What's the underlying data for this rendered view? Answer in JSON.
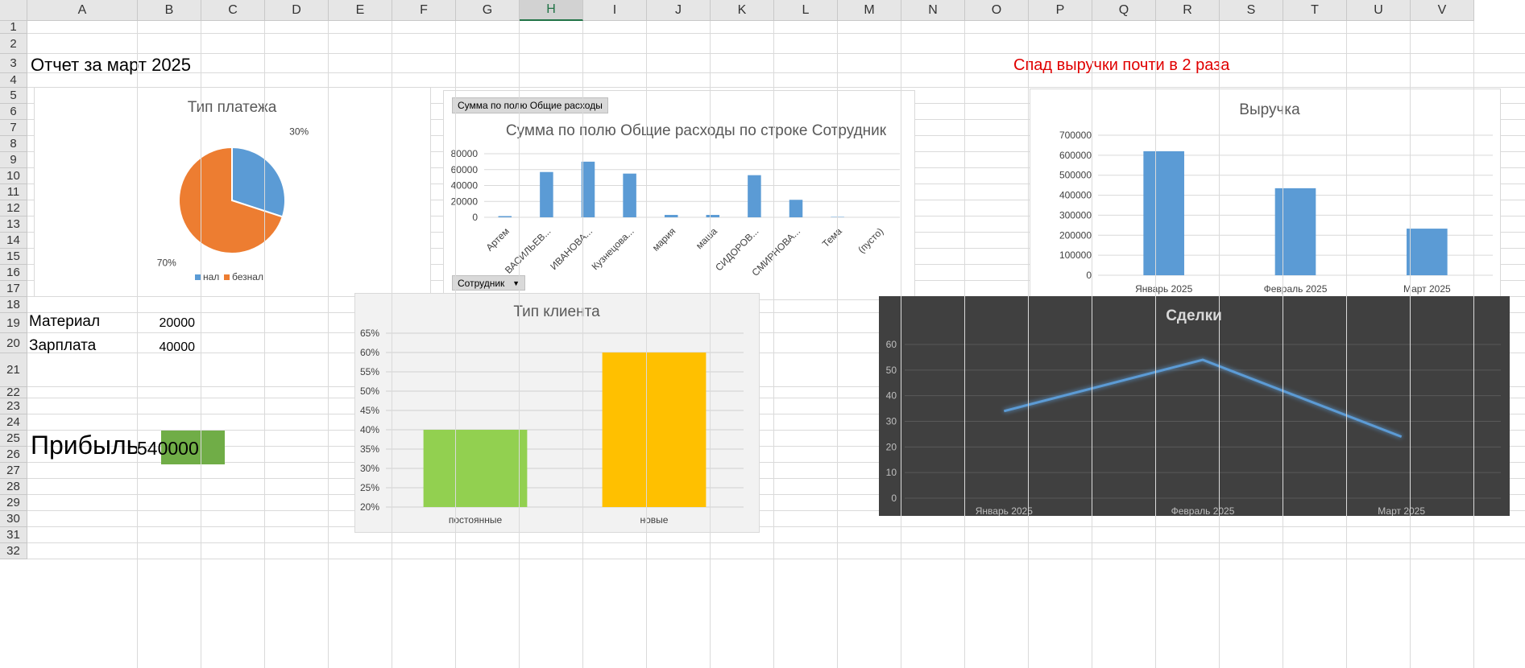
{
  "columns": [
    "A",
    "B",
    "C",
    "D",
    "E",
    "F",
    "G",
    "H",
    "I",
    "J",
    "K",
    "L",
    "M",
    "N",
    "O",
    "P",
    "Q",
    "R",
    "S",
    "T",
    "U",
    "V"
  ],
  "selected_column": "H",
  "rows": [
    "1",
    "2",
    "3",
    "4",
    "5",
    "6",
    "7",
    "8",
    "9",
    "10",
    "11",
    "12",
    "13",
    "14",
    "15",
    "16",
    "17",
    "18",
    "19",
    "20",
    "21",
    "22",
    "23",
    "24",
    "25",
    "26",
    "27",
    "28",
    "29",
    "30",
    "31",
    "32"
  ],
  "cells": {
    "title": "Отчет за март 2025",
    "note": "Спад выручки почти в 2 раза",
    "material_label": "Материал",
    "material_value": "20000",
    "salary_label": "Зарплата",
    "salary_value": "40000",
    "profit_label": "Прибыль",
    "profit_value": "540000"
  },
  "colors": {
    "note": "#e00000",
    "profit_fill": "#70ad47",
    "blue": "#5b9bd5",
    "orange": "#ed7d31",
    "green": "#92d050",
    "yellow": "#ffc000",
    "dark_bg": "#404040"
  },
  "pivot": {
    "field_button": "Сумма по полю Общие расходы",
    "row_button": "Сотрудник",
    "row_button_icon": "dropdown-arrow-icon"
  },
  "chart_data": [
    {
      "id": "payment",
      "type": "pie",
      "title": "Тип платежа",
      "categories": [
        "нал",
        "безнал"
      ],
      "values": [
        30,
        70
      ],
      "data_labels": [
        "30%",
        "70%"
      ],
      "legend": "bottom"
    },
    {
      "id": "expenses",
      "type": "bar",
      "title": "Сумма по полю Общие расходы по строке Сотрудник",
      "categories": [
        "Артем",
        "ВАСИЛЬЕВ...",
        "ИВАНОВА...",
        "Кузнецова...",
        "мария",
        "маша",
        "СИДОРОВ...",
        "СМИРНОВА...",
        "Тема",
        "(пусто)"
      ],
      "values": [
        1500,
        57000,
        70000,
        55000,
        3000,
        3000,
        53000,
        22000,
        500,
        0
      ],
      "yticks": [
        "0",
        "20000",
        "40000",
        "60000",
        "80000"
      ],
      "ylim": [
        0,
        80000
      ],
      "grid": true
    },
    {
      "id": "revenue",
      "type": "bar",
      "title": "Выручка",
      "categories": [
        "Январь 2025",
        "Февраль 2025",
        "Март 2025"
      ],
      "values": [
        620000,
        435000,
        233000
      ],
      "yticks": [
        "0",
        "100000",
        "200000",
        "300000",
        "400000",
        "500000",
        "600000",
        "700000"
      ],
      "ylim": [
        0,
        700000
      ],
      "grid": true
    },
    {
      "id": "client",
      "type": "bar",
      "title": "Тип клиента",
      "categories": [
        "постоянные",
        "новые"
      ],
      "values": [
        40,
        60
      ],
      "yticks": [
        "20%",
        "25%",
        "30%",
        "35%",
        "40%",
        "45%",
        "50%",
        "55%",
        "60%",
        "65%"
      ],
      "ylim": [
        20,
        65
      ],
      "grid": true
    },
    {
      "id": "deals",
      "type": "line",
      "title": "Сделки",
      "categories": [
        "Январь 2025",
        "Февраль 2025",
        "Март 2025"
      ],
      "values": [
        34,
        54,
        24
      ],
      "yticks": [
        "0",
        "10",
        "20",
        "30",
        "40",
        "50",
        "60"
      ],
      "ylim": [
        0,
        60
      ],
      "grid": true
    }
  ]
}
